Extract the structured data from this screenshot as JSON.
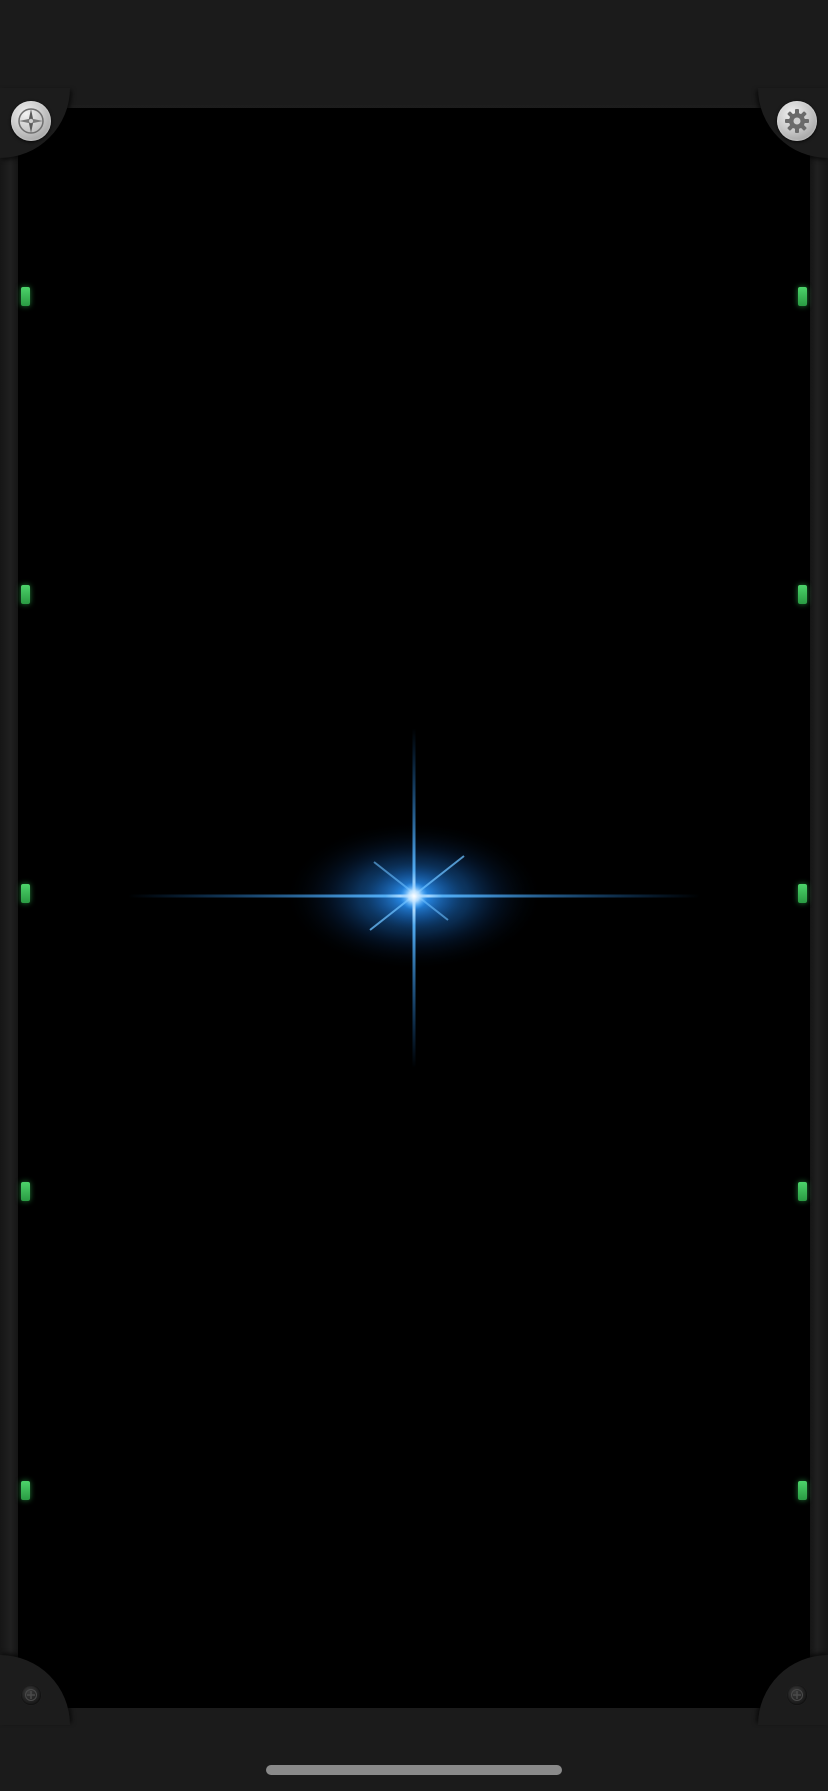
{
  "app": {
    "accent_color": "#1e8fff",
    "led_color": "#43c964",
    "background": "#000000",
    "frame_color": "#1b1b1b"
  },
  "controls": {
    "top_left_icon": "compass-icon",
    "top_right_icon": "gear-icon",
    "bottom_left_icon": "screw-icon",
    "bottom_right_icon": "screw-icon"
  },
  "led_markers": {
    "left_count": 5,
    "right_count": 5
  },
  "aim_flare": {
    "icon": "star-flare-icon"
  }
}
